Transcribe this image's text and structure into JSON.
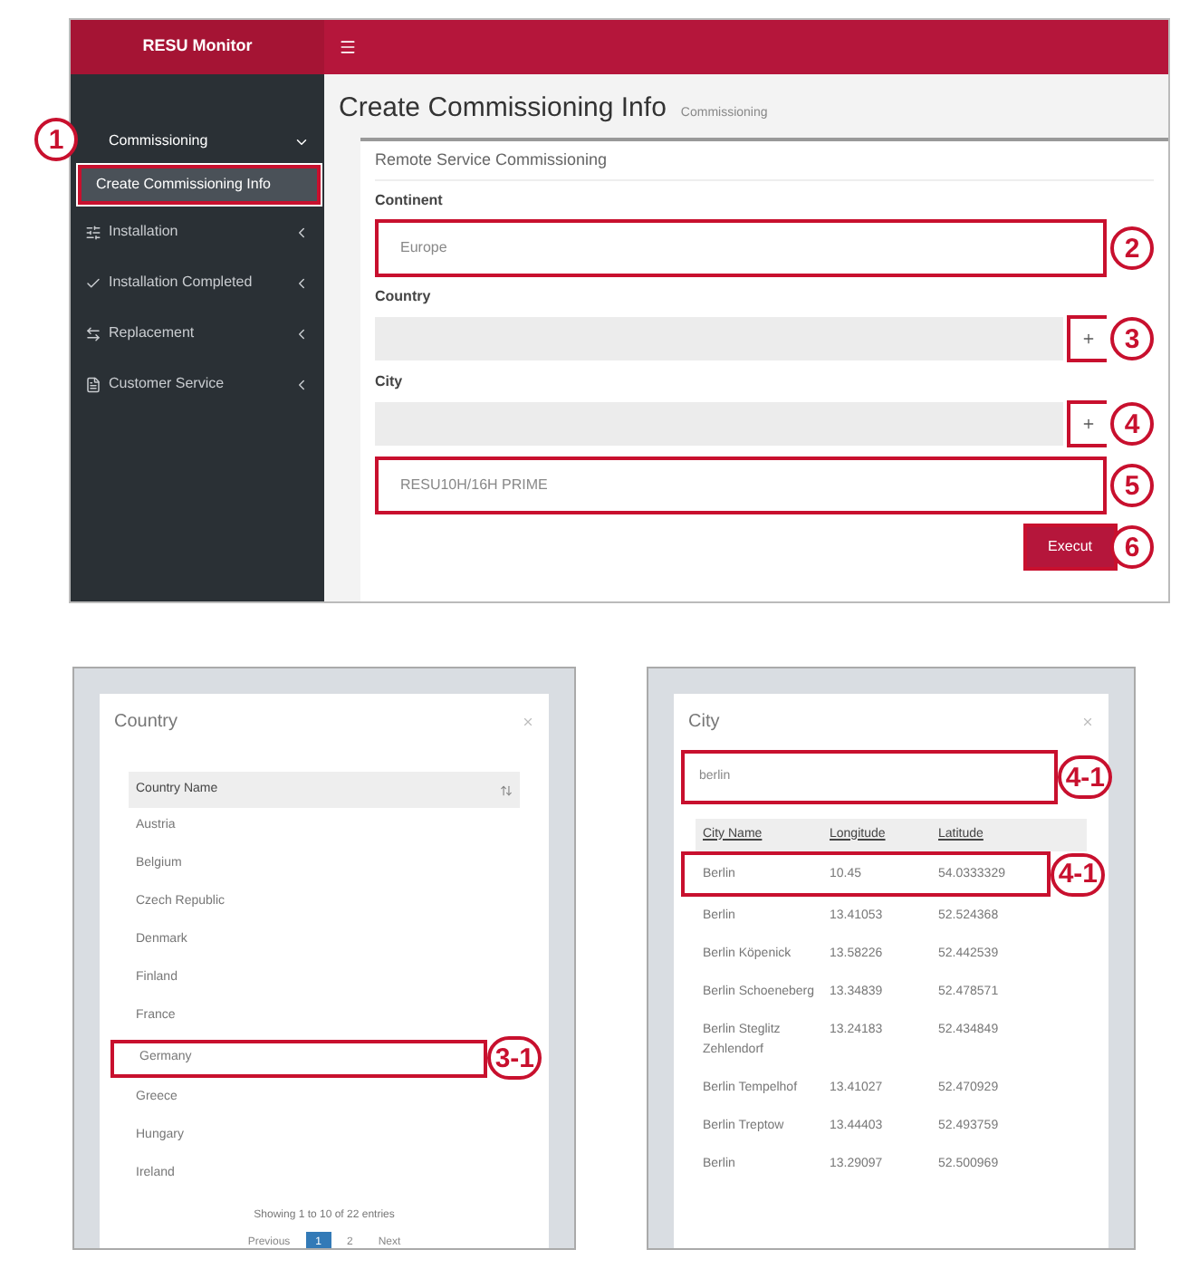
{
  "monitor": {
    "logo": "RESU Monitor",
    "sidebar": {
      "items": [
        {
          "label": "Commissioning",
          "expanded": true,
          "children": [
            {
              "label": "Create Commissioning Info",
              "selected": true,
              "callout": "1"
            }
          ]
        },
        {
          "label": "Installation",
          "expanded": false
        },
        {
          "label": "Installation Completed",
          "expanded": false
        },
        {
          "label": "Replacement",
          "expanded": false
        },
        {
          "label": "Customer Service",
          "expanded": false
        }
      ]
    },
    "page": {
      "title": "Create Commissioning Info",
      "breadcrumb": "Commissioning"
    },
    "form": {
      "heading": "Remote Service Commissioning",
      "fields": [
        {
          "kind": "select",
          "label": "Continent",
          "value": "Europe",
          "callout": "2"
        },
        {
          "kind": "lookup",
          "label": "Country",
          "callout": "3"
        },
        {
          "kind": "lookup",
          "label": "City",
          "callout": "4"
        },
        {
          "kind": "select",
          "value": "RESU10H/16H PRIME",
          "callout": "5"
        }
      ],
      "execute": {
        "label": "Execut",
        "callout": "6"
      }
    }
  },
  "country_dialog": {
    "title": "Country",
    "column": "Country Name",
    "rows": [
      {
        "name": "Austria"
      },
      {
        "name": "Belgium"
      },
      {
        "name": "Czech Republic"
      },
      {
        "name": "Denmark"
      },
      {
        "name": "Finland"
      },
      {
        "name": "France"
      },
      {
        "name": "Germany",
        "callout": "3-1"
      },
      {
        "name": "Greece"
      },
      {
        "name": "Hungary"
      },
      {
        "name": "Ireland"
      }
    ],
    "info": "Showing 1 to 10 of 22 entries",
    "pagination": [
      {
        "label": "Previous",
        "selected": false
      },
      {
        "label": "1",
        "selected": true
      },
      {
        "label": "2",
        "selected": false
      },
      {
        "label": "Next",
        "selected": false
      }
    ]
  },
  "city_dialog": {
    "title": "City",
    "search": {
      "value": "berlin",
      "callout": "4-1"
    },
    "columns": [
      "City Name",
      "Longitude",
      "Latitude"
    ],
    "rows": [
      {
        "cells": [
          "Berlin",
          "10.45",
          "54.0333329"
        ],
        "callout": "4-1"
      },
      {
        "cells": [
          "Berlin",
          "13.41053",
          "52.524368"
        ]
      },
      {
        "cells": [
          "Berlin Köpenick",
          "13.58226",
          "52.442539"
        ]
      },
      {
        "cells": [
          "Berlin Schoeneberg",
          "13.34839",
          "52.478571"
        ]
      },
      {
        "cells": [
          "Berlin Steglitz Zehlendorf",
          "13.24183",
          "52.434849"
        ]
      },
      {
        "cells": [
          "Berlin Tempelhof",
          "13.41027",
          "52.470929"
        ]
      },
      {
        "cells": [
          "Berlin Treptow",
          "13.44403",
          "52.493759"
        ]
      },
      {
        "cells": [
          "Berlin",
          "13.29097",
          "52.500969"
        ]
      }
    ]
  }
}
